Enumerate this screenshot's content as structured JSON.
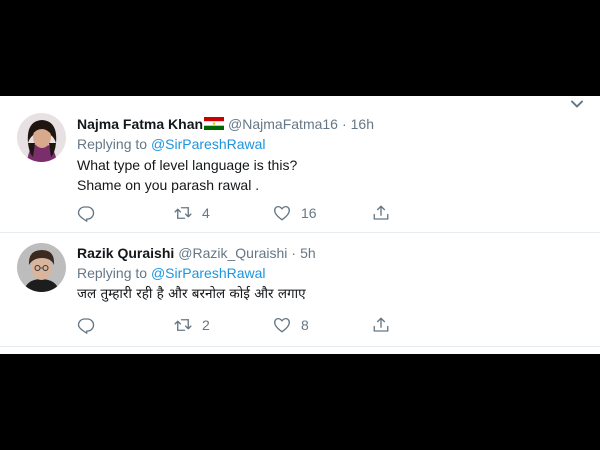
{
  "tweets": [
    {
      "name": "Najma Fatma Khan",
      "handle": "@NajmaFatma16",
      "separator": "·",
      "time": "16h",
      "replying_prefix": "Replying to",
      "replying_to": "@SirPareshRawal",
      "text_lines": [
        "What type of level language is this?",
        "Shame on you parash rawal ."
      ],
      "retweets": "4",
      "likes": "16"
    },
    {
      "name": "Razik Quraishi",
      "handle": "@Razik_Quraishi",
      "separator": "·",
      "time": "5h",
      "replying_prefix": "Replying to",
      "replying_to": "@SirPareshRawal",
      "text_lines": [
        "जल तुम्हारी रही है और बरनोल कोई और लगाए"
      ],
      "retweets": "2",
      "likes": "8"
    }
  ],
  "icons": {
    "reply": "reply-icon",
    "retweet": "retweet-icon",
    "like": "heart-icon",
    "share": "share-icon",
    "caret": "chevron-down-icon",
    "flag": "tajikistan-flag-icon"
  },
  "colors": {
    "link": "#1b95e0",
    "secondary_text": "#657786",
    "divider": "#e6ecf0"
  }
}
